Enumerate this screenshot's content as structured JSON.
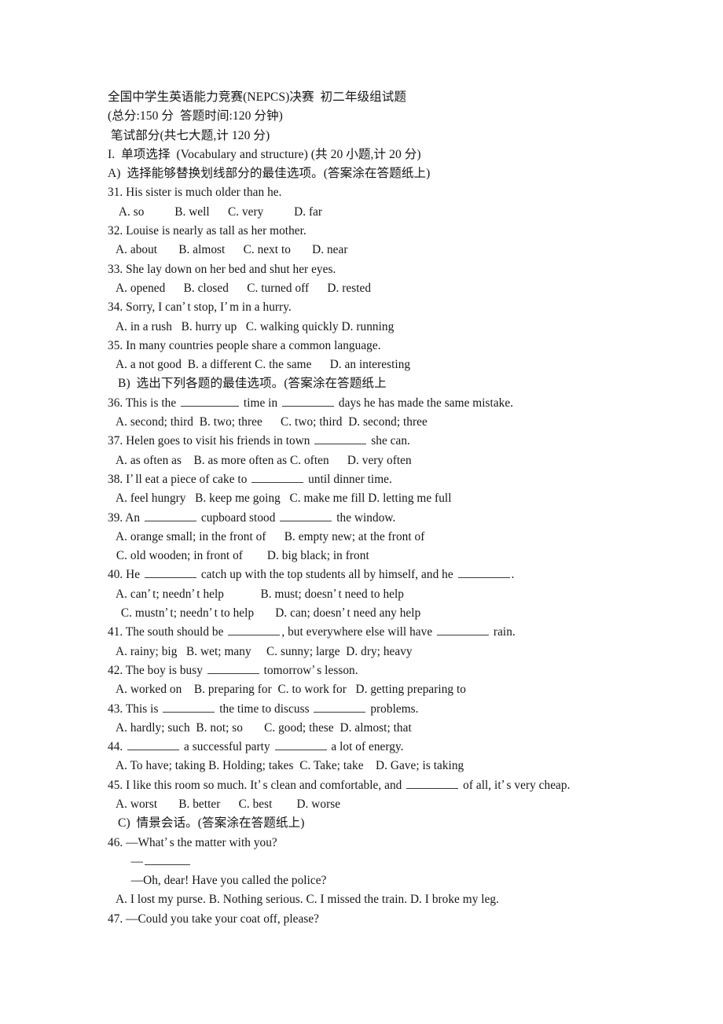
{
  "document": {
    "type": "exam-paper",
    "language": "zh-CN/en",
    "background_color": "#ffffff",
    "text_color": "#161616"
  },
  "header": {
    "title": "全国中学生英语能力竞赛(NEPCS)决赛  初二年级组试题",
    "scoring": "(总分:150 分  答题时间:120 分钟)",
    "section_written": " 笔试部分(共七大题,计 120 分)"
  },
  "section_I": {
    "heading": "I.  单项选择  (Vocabulary and structure) (共 20 小题,计 20 分)",
    "part_A_instruction": "A)  选择能够替换划线部分的最佳选项。(答案涂在答题纸上)",
    "part_B_instruction": "B)  选出下列各题的最佳选项。(答案涂在答题纸上",
    "part_C_instruction": "C)  情景会话。(答案涂在答题纸上)"
  },
  "questions": [
    {
      "number": "31.",
      "stem": "31. His sister is much older than he.",
      "options_line": "  A. so          B. well      C. very          D. far"
    },
    {
      "number": "32.",
      "stem": "32. Louise is nearly as tall as her mother.",
      "options_line": " A. about       B. almost      C. next to       D. near"
    },
    {
      "number": "33.",
      "stem": "33. She lay down on her bed and shut her eyes.",
      "options_line": " A. opened      B. closed      C. turned off      D. rested"
    },
    {
      "number": "34.",
      "stem_pre": "34. Sorry, I can",
      "stem_mid": "t stop, I",
      "stem_post": "m in a hurry.",
      "options_line": " A. in a rush   B. hurry up   C. walking quickly D. running"
    },
    {
      "number": "35.",
      "stem": "35. In many countries people share a common language.",
      "options_line": " A. a not good  B. a different C. the same      D. an interesting"
    },
    {
      "number": "36.",
      "stem_a": "36. This is the ",
      "stem_b": " time in ",
      "stem_c": " days he has made the same mistake.",
      "options_line": " A. second; third  B. two; three      C. two; third  D. second; three"
    },
    {
      "number": "37.",
      "stem_a": "37. Helen goes to visit his friends in town ",
      "stem_b": " she can.",
      "options_line": " A. as often as    B. as more often as C. often      D. very often"
    },
    {
      "number": "38.",
      "stem_a": "38. I",
      "stem_b": "ll eat a piece of cake to ",
      "stem_c": " until dinner time.",
      "options_line": " A. feel hungry   B. keep me going   C. make me fill D. letting me full"
    },
    {
      "number": "39.",
      "stem_a": "39. An ",
      "stem_b": " cupboard stood ",
      "stem_c": " the window.",
      "options_line_1": " A. orange small; in the front of      B. empty new; at the front of",
      "options_line_2": " C. old wooden; in front of        D. big black; in front"
    },
    {
      "number": "40.",
      "stem_a": "40. He ",
      "stem_b": " catch up with the top students all by himself, and he ",
      "stem_c": ".",
      "options_line_1_a": " A. can",
      "options_line_1_b": "t; needn",
      "options_line_1_c": "t help            B. must; doesn",
      "options_line_1_d": "t need to help",
      "options_line_2_a": " C. mustn",
      "options_line_2_b": "t; needn",
      "options_line_2_c": "t to help       D. can; doesn",
      "options_line_2_d": "t need any help"
    },
    {
      "number": "41.",
      "stem_a": "41. The south should be ",
      "stem_b": ", but everywhere else will have ",
      "stem_c": " rain.",
      "options_line": " A. rainy; big   B. wet; many     C. sunny; large  D. dry; heavy"
    },
    {
      "number": "42.",
      "stem_a": "42. The boy is busy ",
      "stem_b": " tomorrow",
      "stem_c": "s lesson.",
      "options_line": " A. worked on    B. preparing for  C. to work for   D. getting preparing to"
    },
    {
      "number": "43.",
      "stem_a": "43. This is ",
      "stem_b": " the time to discuss ",
      "stem_c": " problems.",
      "options_line": " A. hardly; such  B. not; so       C. good; these  D. almost; that"
    },
    {
      "number": "44.",
      "stem_a": "44. ",
      "stem_b": " a successful party ",
      "stem_c": " a lot of energy.",
      "options_line": " A. To have; taking B. Holding; takes  C. Take; take    D. Gave; is taking"
    },
    {
      "number": "45.",
      "stem_a": "45. I like this room so much. It",
      "stem_b": "s clean and comfortable, and ",
      "stem_c": " of all, it",
      "stem_d": "s very cheap.",
      "options_line": " A. worst       B. better      C. best        D. worse"
    },
    {
      "number": "46.",
      "stem_a": "46. —What",
      "stem_b": "s the matter with you?",
      "answer_blank_line": "  —",
      "reply_line": "  —Oh, dear! Have you called the police?",
      "options_line": " A. I lost my purse. B. Nothing serious. C. I missed the train. D. I broke my leg."
    },
    {
      "number": "47.",
      "stem": "47. —Could you take your coat off, please?"
    }
  ],
  "glyphs": {
    "apostrophe": "’",
    "dash": "—"
  }
}
